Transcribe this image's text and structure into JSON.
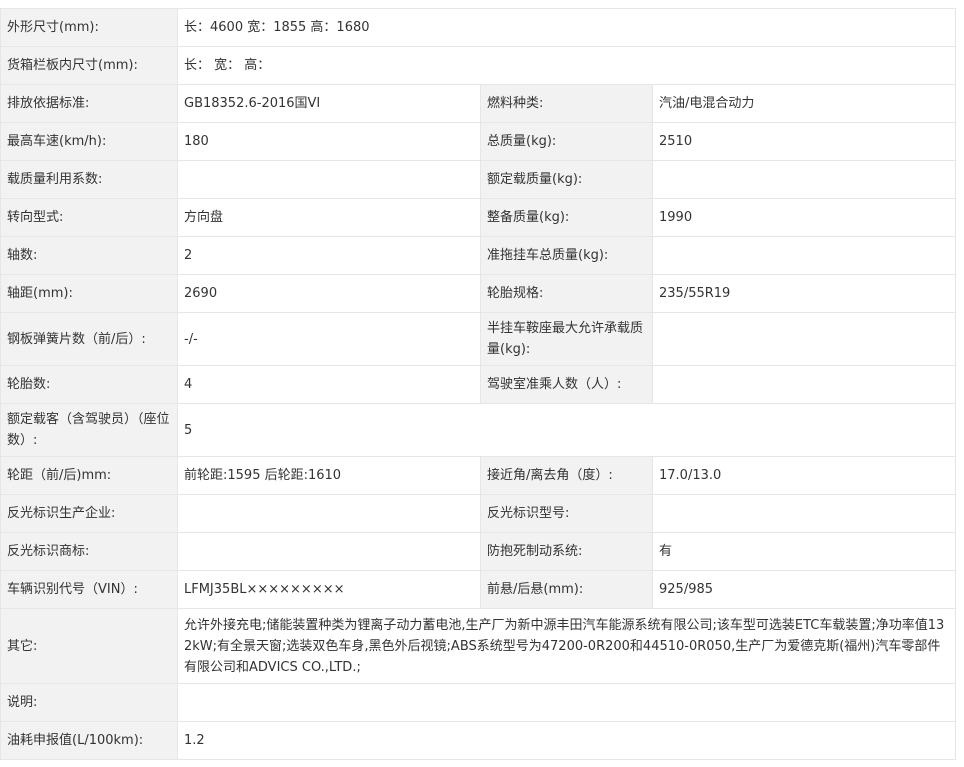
{
  "rows": {
    "dimensions": {
      "label": "外形尺寸(mm):",
      "value": "长：4600 宽：1855 高：1680"
    },
    "cargo_box": {
      "label": "货箱栏板内尺寸(mm):",
      "value": "长：  宽：  高："
    },
    "emission": {
      "label": "排放依据标准:",
      "value": "GB18352.6-2016国VI",
      "label2": "燃料种类:",
      "value2": "汽油/电混合动力"
    },
    "max_speed": {
      "label": "最高车速(km/h):",
      "value": "180",
      "label2": "总质量(kg):",
      "value2": "2510"
    },
    "load_factor": {
      "label": "载质量利用系数:",
      "value": "",
      "label2": "额定载质量(kg):",
      "value2": ""
    },
    "steering": {
      "label": "转向型式:",
      "value": "方向盘",
      "label2": "整备质量(kg):",
      "value2": "1990"
    },
    "axles": {
      "label": "轴数:",
      "value": "2",
      "label2": "准拖挂车总质量(kg):",
      "value2": ""
    },
    "wheelbase": {
      "label": "轴距(mm):",
      "value": "2690",
      "label2": "轮胎规格:",
      "value2": "235/55R19"
    },
    "leaf_spring": {
      "label": "钢板弹簧片数（前/后）:",
      "value": "-/-",
      "label2": "半挂车鞍座最大允许承载质量(kg):",
      "value2": ""
    },
    "tires": {
      "label": "轮胎数:",
      "value": "4",
      "label2": "驾驶室准乘人数（人）:",
      "value2": ""
    },
    "seats": {
      "label": "额定载客（含驾驶员）（座位数）:",
      "value": "5"
    },
    "track": {
      "label": "轮距（前/后)mm:",
      "value": "前轮距:1595 后轮距:1610",
      "label2": "接近角/离去角（度）:",
      "value2": "17.0/13.0"
    },
    "reflector_maker": {
      "label": "反光标识生产企业:",
      "value": "",
      "label2": "反光标识型号:",
      "value2": ""
    },
    "reflector_brand": {
      "label": "反光标识商标:",
      "value": "",
      "label2": "防抱死制动系统:",
      "value2": "有"
    },
    "vin": {
      "label": "车辆识别代号（VIN）:",
      "value": "LFMJ35BL×××××××××",
      "label2": "前悬/后悬(mm):",
      "value2": "925/985"
    },
    "other": {
      "label": "其它:",
      "value": "允许外接充电;储能装置种类为锂离子动力蓄电池,生产厂为新中源丰田汽车能源系统有限公司;该车型可选装ETC车载装置;净功率值132kW;有全景天窗;选装双色车身,黑色外后视镜;ABS系统型号为47200-0R200和44510-0R050,生产厂为爱德克斯(福州)汽车零部件有限公司和ADVICS CO.,LTD.;"
    },
    "notes": {
      "label": "说明:",
      "value": ""
    },
    "fuel": {
      "label": "油耗申报值(L/100km):",
      "value": "1.2"
    }
  }
}
